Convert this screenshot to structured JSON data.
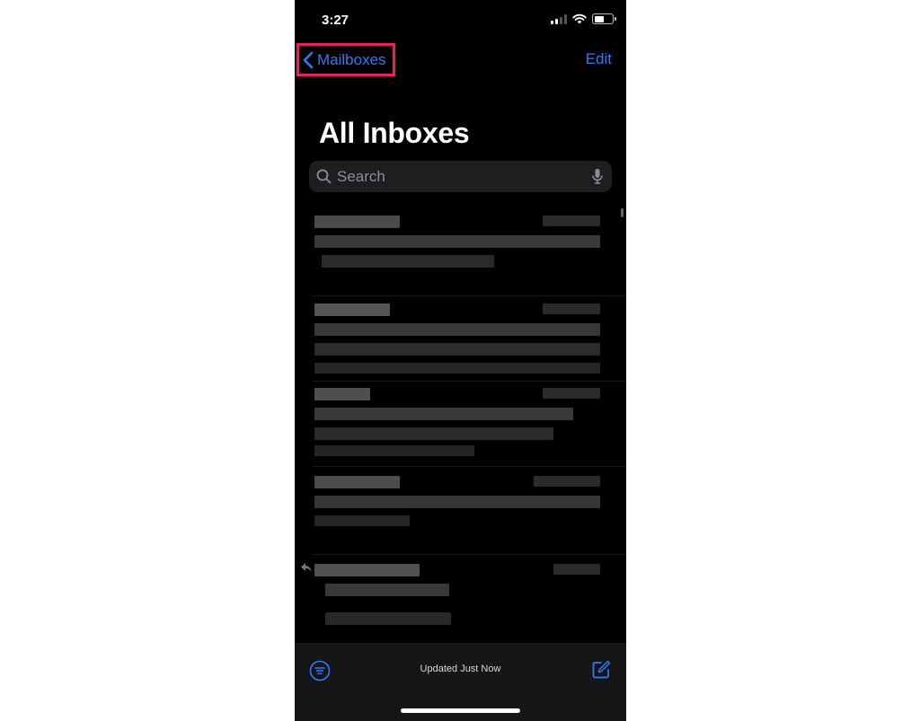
{
  "status_bar": {
    "time": "3:27"
  },
  "nav": {
    "back_label": "Mailboxes",
    "edit_label": "Edit"
  },
  "page": {
    "title": "All Inboxes"
  },
  "search": {
    "placeholder": "Search"
  },
  "message_list": {
    "count": 5,
    "content": "pixelated/blurred"
  },
  "toolbar": {
    "status_text": "Updated Just Now"
  },
  "icons": {
    "back": "chevron-left-icon",
    "search": "search-icon",
    "mic": "microphone-icon",
    "filter": "filter-icon",
    "compose": "compose-icon",
    "reply": "reply-icon"
  },
  "colors": {
    "accent": "#2e7cf6",
    "highlight": "#e0245e",
    "background": "#000000"
  }
}
